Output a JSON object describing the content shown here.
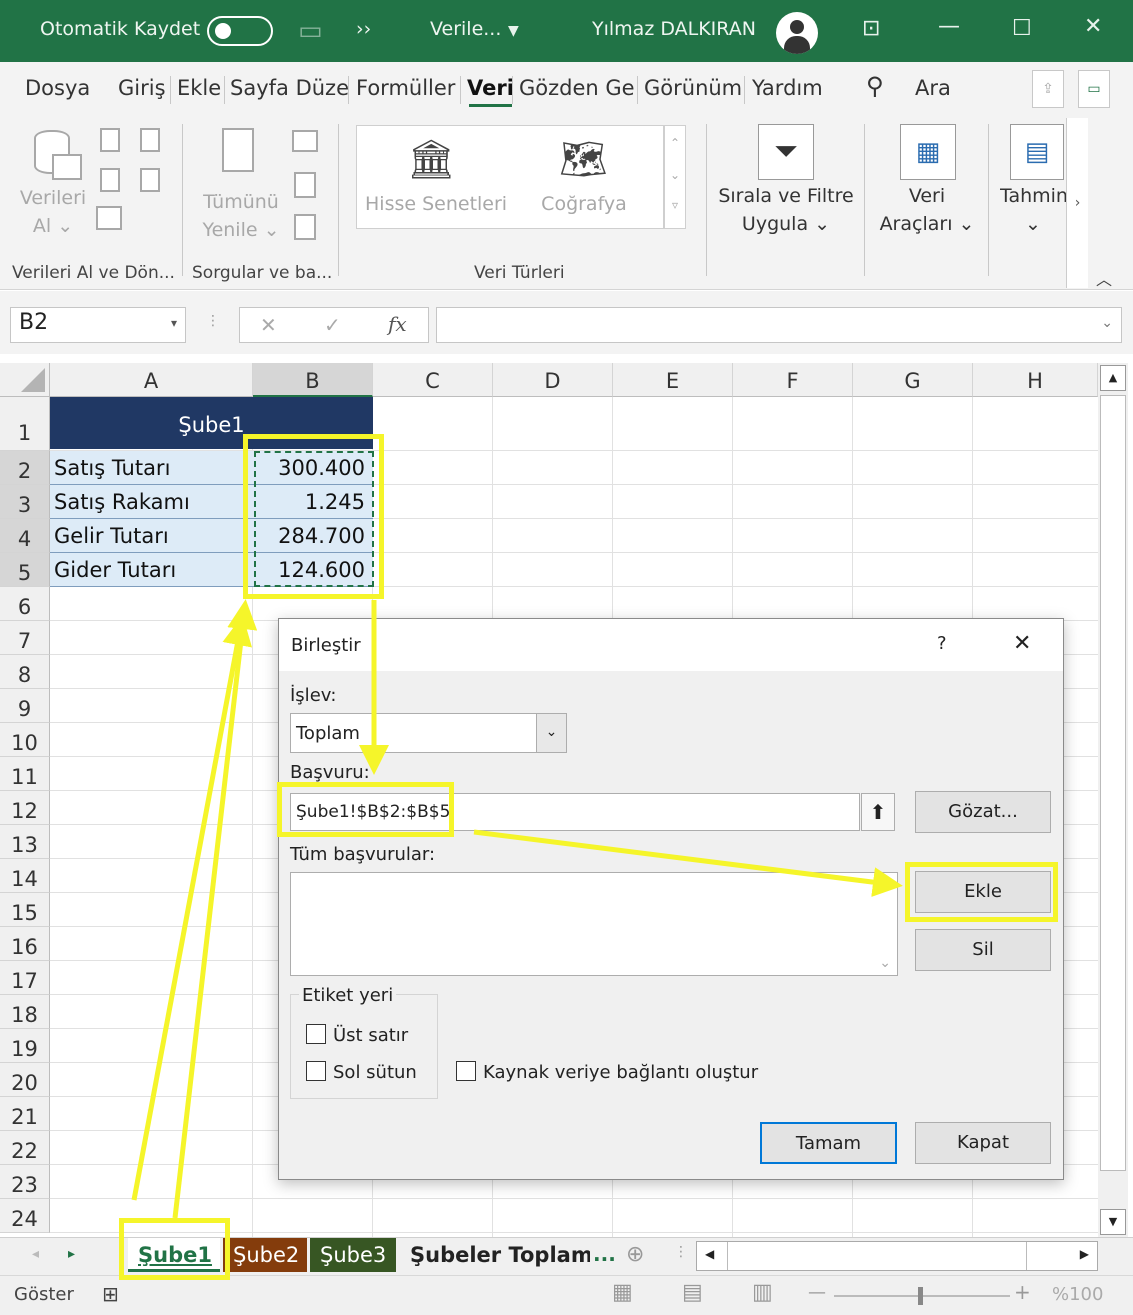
{
  "titlebar": {
    "autosave_label": "Otomatik Kaydet",
    "more_glyph": "››",
    "filename": "Verile...",
    "user": "Yılmaz DALKIRAN"
  },
  "ribbon_tabs": [
    "Dosya",
    "Giriş",
    "Ekle",
    "Sayfa Düze",
    "Formüller",
    "Veri",
    "Gözden Ge",
    "Görünüm",
    "Yardım"
  ],
  "active_tab": "Veri",
  "search_label": "Ara",
  "ribbon": {
    "get_data_l1": "Verileri",
    "get_data_l2": "Al ⌄",
    "refresh_l1": "Tümünü",
    "refresh_l2": "Yenile ⌄",
    "stocks": "Hisse Senetleri",
    "geography": "Coğrafya",
    "sort_filter_l1": "Sırala ve Filtre",
    "sort_filter_l2": "Uygula ⌄",
    "data_tools_l1": "Veri",
    "data_tools_l2": "Araçları ⌄",
    "forecast_l1": "Tahmin",
    "forecast_l2": "⌄",
    "groups": {
      "get_transform": "Verileri Al ve Dön...",
      "queries": "Sorgular ve ba...",
      "data_types": "Veri Türleri"
    }
  },
  "formula_bar": {
    "name_box": "B2",
    "cancel": "✕",
    "enter": "✓",
    "fx": "fx",
    "value": ""
  },
  "columns": [
    "A",
    "B",
    "C",
    "D",
    "E",
    "F",
    "G",
    "H"
  ],
  "rows": [
    "1",
    "2",
    "3",
    "4",
    "5",
    "6",
    "7",
    "8",
    "9",
    "10",
    "11",
    "12",
    "13",
    "14",
    "15",
    "16",
    "17",
    "18",
    "19",
    "20",
    "21",
    "22",
    "23",
    "24"
  ],
  "sheet": {
    "header": "Şube1",
    "labels": [
      "Satış Tutarı",
      "Satış Rakamı",
      "Gelir Tutarı",
      "Gider Tutarı"
    ],
    "values": [
      "300.400",
      "1.245",
      "284.700",
      "124.600"
    ]
  },
  "sheet_tabs": [
    "Şube1",
    "Şube2",
    "Şube3",
    "Şubeler Toplamı"
  ],
  "sheet_tabs_more": "...",
  "status": {
    "left": "Göster",
    "zoom": "%100"
  },
  "dialog": {
    "title": "Birleştir",
    "help": "?",
    "close": "✕",
    "function_label": "İşlev:",
    "function_value": "Toplam",
    "reference_label": "Başvuru:",
    "reference_value": "Şube1!$B$2:$B$5",
    "browse": "Gözat...",
    "all_refs_label": "Tüm başvurular:",
    "add": "Ekle",
    "delete": "Sil",
    "labels_group": "Etiket yeri",
    "top_row": "Üst satır",
    "left_col": "Sol sütun",
    "link_source": "Kaynak veriye bağlantı oluştur",
    "ok": "Tamam",
    "cancel": "Kapat"
  },
  "colors": {
    "excel_green": "#217346",
    "header_fill": "#203864",
    "table_fill": "#ddebf7",
    "highlight": "#f5f52a"
  }
}
